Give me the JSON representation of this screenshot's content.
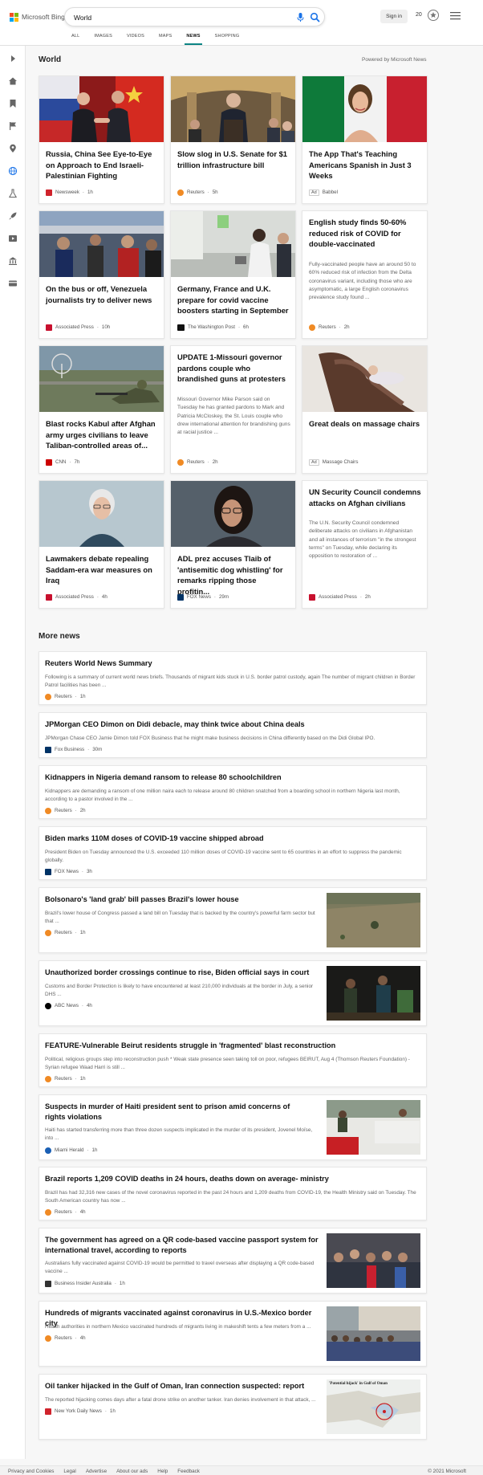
{
  "header": {
    "logo_text": "Microsoft Bing",
    "search_query": "World",
    "sign_in": "Sign in",
    "rewards_points": "20"
  },
  "tabs": [
    "ALL",
    "IMAGES",
    "VIDEOS",
    "MAPS",
    "NEWS",
    "SHOPPING"
  ],
  "active_tab": "NEWS",
  "world": {
    "title": "World",
    "powered_by": "Powered by Microsoft News"
  },
  "cards": [
    {
      "title": "Russia, China See Eye-to-Eye on Approach to End Israeli-Palestinian Fighting",
      "source": "Newsweek",
      "time": "1h",
      "icon_color": "#d0232c"
    },
    {
      "title": "Slow slog in U.S. Senate for $1 trillion infrastructure bill",
      "source": "Reuters",
      "time": "5h",
      "icon_color": "#f08a24"
    },
    {
      "title": "The App That's Teaching Americans Spanish in Just 3 Weeks",
      "source": "Babbel",
      "ad_label": "Ad",
      "icon_color": ""
    },
    {
      "title": "On the bus or off, Venezuela journalists try to deliver news",
      "source": "Associated Press",
      "time": "10h",
      "icon_color": "#c8102e"
    },
    {
      "title": "Germany, France and U.K. prepare for covid vaccine boosters starting in September",
      "source": "The Washington Post",
      "time": "6h",
      "icon_color": "#111111"
    },
    {
      "title": "English study finds 50-60% reduced risk of COVID for double-vaccinated",
      "snippet": "Fully-vaccinated people have an around 50 to 60% reduced risk of infection from the Delta coronavirus variant, including those who are asymptomatic, a large English coronavirus prevalence study found ...",
      "source": "Reuters",
      "time": "2h",
      "icon_color": "#f08a24"
    },
    {
      "title": "Blast rocks Kabul after Afghan army urges civilians to leave Taliban-controlled areas of...",
      "source": "CNN",
      "time": "7h",
      "icon_color": "#cc0000"
    },
    {
      "title": "UPDATE 1-Missouri governor pardons couple who brandished guns at protesters",
      "snippet": "Missouri Governor Mike Parson said on Tuesday he has granted pardons to Mark and Patricia McCloskey, the St. Louis couple who drew international attention for brandishing guns at racial justice ...",
      "source": "Reuters",
      "time": "2h",
      "icon_color": "#f08a24"
    },
    {
      "title": "Great deals on massage chairs",
      "source": "Massage Chairs",
      "ad_label": "Ad",
      "icon_color": ""
    },
    {
      "title": "Lawmakers debate repealing Saddam-era war measures on Iraq",
      "source": "Associated Press",
      "time": "4h",
      "icon_color": "#c8102e"
    },
    {
      "title": "ADL prez accuses Tlaib of 'antisemitic dog whistling' for remarks ripping those profitin...",
      "source": "FOX News",
      "time": "29m",
      "icon_color": "#003366"
    },
    {
      "title": "UN Security Council condemns attacks on Afghan civilians",
      "snippet": "The U.N. Security Council condemned deliberate attacks on civilians in Afghanistan and all instances of terrorism \"in the strongest terms\" on Tuesday, while declaring its opposition to restoration of ...",
      "source": "Associated Press",
      "time": "2h",
      "icon_color": "#c8102e"
    }
  ],
  "more_news_title": "More news",
  "more_news": [
    {
      "title": "Reuters World News Summary",
      "snippet": "Following is a summary of current world news briefs. Thousands of migrant kids stuck in U.S. border patrol custody, again The number of migrant children in Border Patrol facilities has been ...",
      "source": "Reuters",
      "time": "1h",
      "icon_color": "#f08a24"
    },
    {
      "title": "JPMorgan CEO Dimon on Didi debacle, may think twice about China deals",
      "snippet": "JPMorgan Chase CEO Jamie Dimon told FOX Business that he might make business decisions in China differently based on the Didi Global IPO.",
      "source": "Fox Business",
      "time": "30m",
      "icon_color": "#003366"
    },
    {
      "title": "Kidnappers in Nigeria demand ransom to release 80 schoolchildren",
      "snippet": "Kidnappers are demanding a ransom of one million naira each to release around 80 children snatched from a boarding school in northern Nigeria last month, according to a pastor involved in the ...",
      "source": "Reuters",
      "time": "2h",
      "icon_color": "#f08a24"
    },
    {
      "title": "Biden marks 110M doses of COVID-19 vaccine shipped abroad",
      "snippet": "President Biden on Tuesday announced the U.S. exceeded 110 million doses of COVID-19 vaccine sent to 65 countries in an effort to suppress the pandemic globally.",
      "source": "FOX News",
      "time": "3h",
      "icon_color": "#003366"
    },
    {
      "title": "Bolsonaro's 'land grab' bill passes Brazil's lower house",
      "snippet": "Brazil's lower house of Congress passed a land bill on Tuesday that is backed by the country's powerful farm sector but that ...",
      "source": "Reuters",
      "time": "1h",
      "icon_color": "#f08a24"
    },
    {
      "title": "Unauthorized border crossings continue to rise, Biden official says in court",
      "snippet": "Customs and Border Protection is likely to have encountered at least 210,000 individuals at the border in July, a senior DHS ...",
      "source": "ABC News",
      "time": "4h",
      "icon_color": "#000000"
    },
    {
      "title": "FEATURE-Vulnerable Beirut residents struggle in 'fragmented' blast reconstruction",
      "snippet": "Political, religious groups step into reconstruction push * Weak state presence seen taking toll on poor, refugees BEIRUT, Aug 4 (Thomson Reuters Foundation) - Syrian refugee Waad Harri is still ...",
      "source": "Reuters",
      "time": "1h",
      "icon_color": "#f08a24"
    },
    {
      "title": "Suspects in murder of Haiti president sent to prison amid concerns of rights violations",
      "snippet": "Haiti has started transferring more than three dozen suspects implicated in the murder of its president, Jovenel Moïse, into ...",
      "source": "Miami Herald",
      "time": "1h",
      "icon_color": "#1a5fb4"
    },
    {
      "title": "Brazil reports 1,209 COVID deaths in 24 hours, deaths down on average- ministry",
      "snippet": "Brazil has had 32,316 new cases of the novel coronavirus reported in the past 24 hours and 1,209 deaths from COVID-19, the Health Ministry said on Tuesday. The South American country has now ...",
      "source": "Reuters",
      "time": "4h",
      "icon_color": "#f08a24"
    },
    {
      "title": "The government has agreed on a QR code-based vaccine passport system for international travel, according to reports",
      "snippet": "Australians fully vaccinated against COVID-19 would be permitted to travel overseas after displaying a QR code-based vaccine ...",
      "source": "Business Insider Australia",
      "time": "1h",
      "icon_color": "#333333"
    },
    {
      "title": "Hundreds of migrants vaccinated against coronavirus in U.S.-Mexico border city",
      "snippet": "Health authorities in northern Mexico vaccinated hundreds of migrants living in makeshift tents a few meters from a ...",
      "source": "Reuters",
      "time": "4h",
      "icon_color": "#f08a24"
    },
    {
      "title": "Oil tanker hijacked in the Gulf of Oman, Iran connection suspected: report",
      "snippet": "The reported hijacking comes days after a fatal drone strike on another tanker. Iran denies involvement in that attack, ...",
      "source": "New York Daily News",
      "time": "1h",
      "icon_color": "#d0232c",
      "thumb_caption": "'Potential hijack' in Gulf of Oman"
    }
  ],
  "footer": {
    "links": [
      "Privacy and Cookies",
      "Legal",
      "Advertise",
      "About our ads",
      "Help",
      "Feedback"
    ],
    "copyright": "© 2021 Microsoft"
  }
}
